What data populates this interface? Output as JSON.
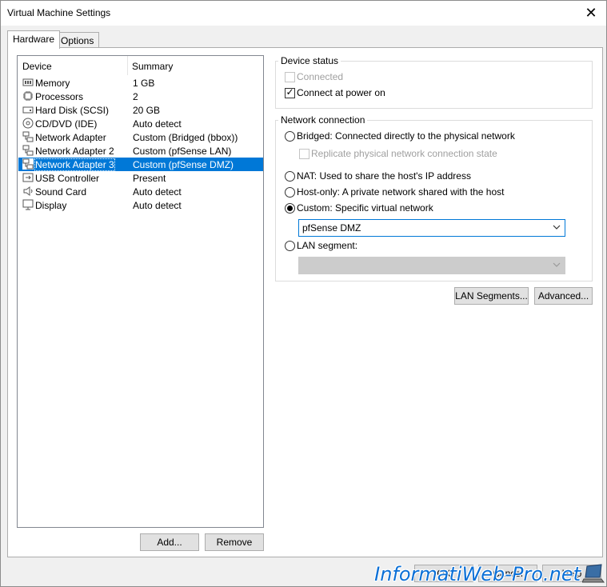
{
  "window": {
    "title": "Virtual Machine Settings",
    "close_glyph": "✕"
  },
  "tabs": [
    {
      "label": "Hardware",
      "active": true
    },
    {
      "label": "Options",
      "active": false
    }
  ],
  "device_list": {
    "headers": {
      "device": "Device",
      "summary": "Summary"
    },
    "items": [
      {
        "icon": "memory-icon",
        "device": "Memory",
        "summary": "1 GB",
        "selected": false
      },
      {
        "icon": "processor-icon",
        "device": "Processors",
        "summary": "2",
        "selected": false
      },
      {
        "icon": "hard-disk-icon",
        "device": "Hard Disk (SCSI)",
        "summary": "20 GB",
        "selected": false
      },
      {
        "icon": "cd-dvd-icon",
        "device": "CD/DVD (IDE)",
        "summary": "Auto detect",
        "selected": false
      },
      {
        "icon": "network-adapter-icon",
        "device": "Network Adapter",
        "summary": "Custom (Bridged (bbox))",
        "selected": false
      },
      {
        "icon": "network-adapter-icon",
        "device": "Network Adapter 2",
        "summary": "Custom (pfSense LAN)",
        "selected": false
      },
      {
        "icon": "network-adapter-icon",
        "device": "Network Adapter 3",
        "summary": "Custom (pfSense DMZ)",
        "selected": true
      },
      {
        "icon": "usb-icon",
        "device": "USB Controller",
        "summary": "Present",
        "selected": false
      },
      {
        "icon": "sound-card-icon",
        "device": "Sound Card",
        "summary": "Auto detect",
        "selected": false
      },
      {
        "icon": "display-icon",
        "device": "Display",
        "summary": "Auto detect",
        "selected": false
      }
    ]
  },
  "device_buttons": {
    "add": "Add...",
    "remove": "Remove"
  },
  "device_status": {
    "title": "Device status",
    "connected": {
      "label": "Connected",
      "checked": false,
      "enabled": false
    },
    "connect_at_power_on": {
      "label": "Connect at power on",
      "checked": true,
      "enabled": true
    }
  },
  "network_connection": {
    "title": "Network connection",
    "bridged": {
      "label": "Bridged: Connected directly to the physical network",
      "selected": false
    },
    "replicate": {
      "label": "Replicate physical network connection state",
      "checked": false,
      "enabled": false
    },
    "nat": {
      "label": "NAT: Used to share the host's IP address",
      "selected": false
    },
    "host_only": {
      "label": "Host-only: A private network shared with the host",
      "selected": false
    },
    "custom": {
      "label": "Custom: Specific virtual network",
      "selected": true
    },
    "custom_network_value": "pfSense DMZ",
    "lan_segment": {
      "label": "LAN segment:",
      "selected": false
    },
    "lan_segment_value": ""
  },
  "net_buttons": {
    "lan_segments": "LAN Segments...",
    "advanced": "Advanced..."
  },
  "dialog_buttons": {
    "ok": "OK",
    "cancel": "Cancel",
    "help": "Help"
  },
  "watermark": "InformatiWeb-Pro.net",
  "colors": {
    "selection": "#0078d7",
    "watermark": "#0a6fd6"
  }
}
